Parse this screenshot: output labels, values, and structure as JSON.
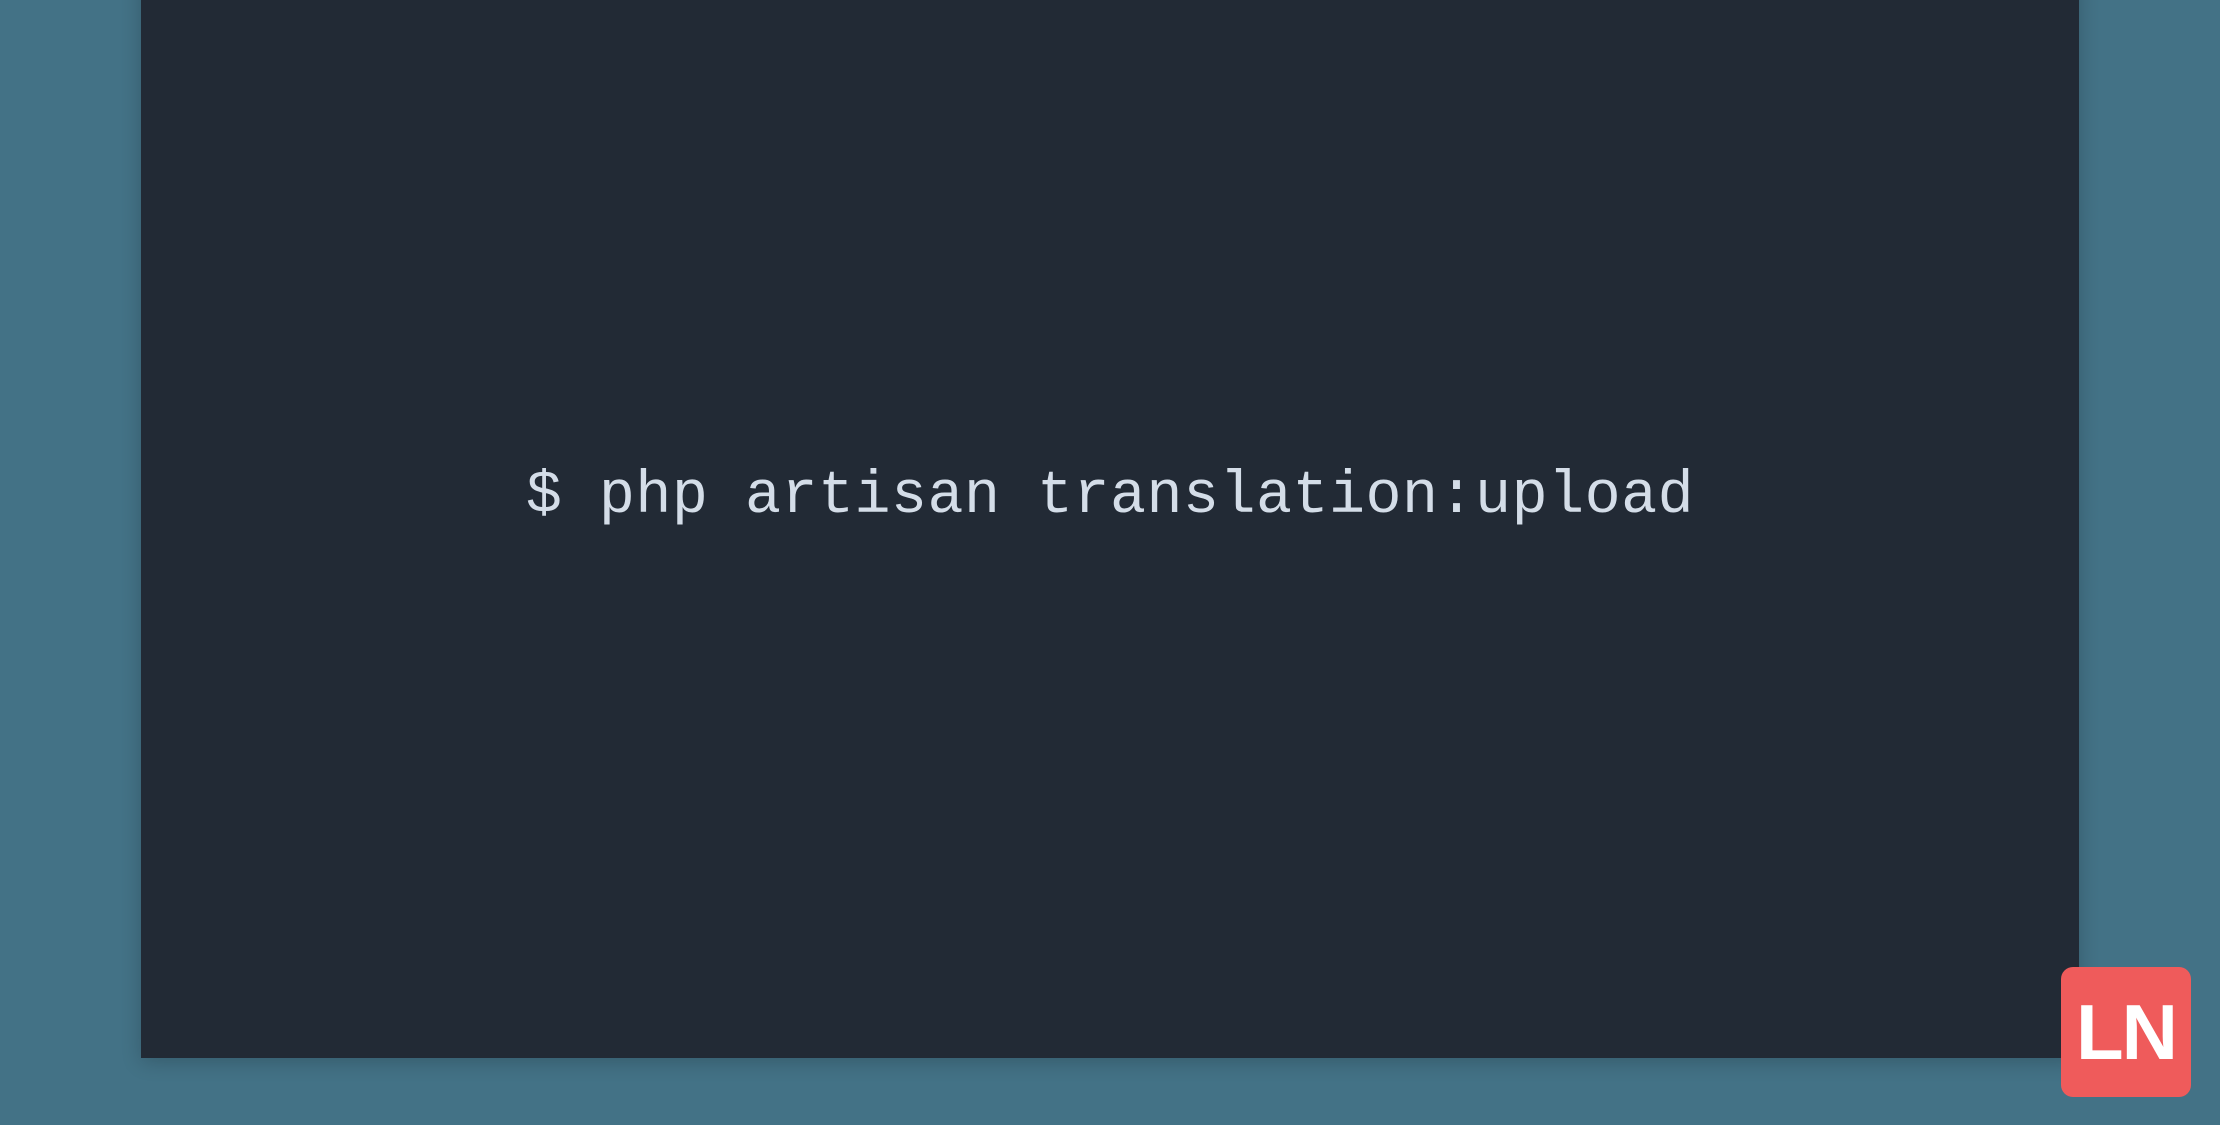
{
  "terminal": {
    "command": "$ php artisan translation:upload"
  },
  "logo": {
    "text_l": "L",
    "text_n": "N"
  },
  "colors": {
    "background": "#437286",
    "terminal_bg": "#222a35",
    "titlebar_bg": "#e8eef0",
    "text": "#d4dde8",
    "badge": "#ef5b5b",
    "traffic_red": "#ed6a5e",
    "traffic_yellow": "#f5be4f",
    "traffic_green": "#61c454"
  }
}
